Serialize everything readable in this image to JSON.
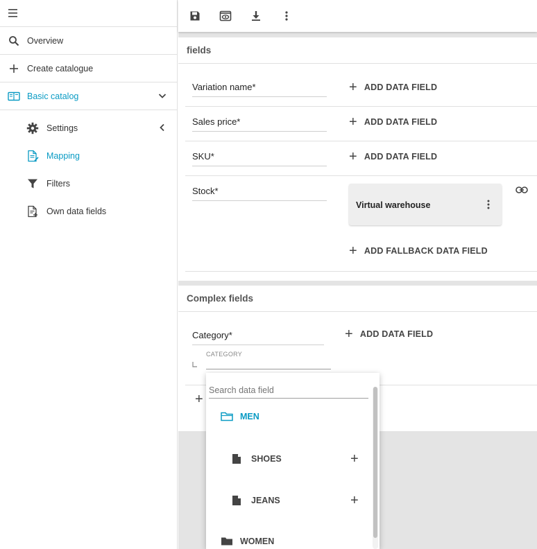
{
  "sidebar": {
    "overview": "Overview",
    "create_catalogue": "Create catalogue",
    "basic_catalog": "Basic catalog",
    "settings": "Settings",
    "mapping": "Mapping",
    "filters": "Filters",
    "own_data_fields": "Own data fields"
  },
  "fields_card": {
    "title": "fields",
    "rows": [
      {
        "name": "Variation name*",
        "action": "ADD DATA FIELD"
      },
      {
        "name": "Sales price*",
        "action": "ADD DATA FIELD"
      },
      {
        "name": "SKU*",
        "action": "ADD DATA FIELD"
      },
      {
        "name": "Stock*",
        "source": "Virtual warehouse",
        "action": "ADD FALLBACK DATA FIELD"
      }
    ]
  },
  "complex_card": {
    "title": "Complex fields",
    "category_name": "Category*",
    "category_sublabel": "CATEGORY",
    "action": "ADD DATA FIELD"
  },
  "dropdown": {
    "search_placeholder": "Search data field",
    "items": [
      {
        "label": "MEN",
        "type": "folder-open"
      },
      {
        "label": "SHOES",
        "type": "file"
      },
      {
        "label": "JEANS",
        "type": "file"
      },
      {
        "label": "WOMEN",
        "type": "folder"
      }
    ]
  },
  "colors": {
    "accent": "#0a9bc4",
    "background": "#e4e4e4"
  }
}
